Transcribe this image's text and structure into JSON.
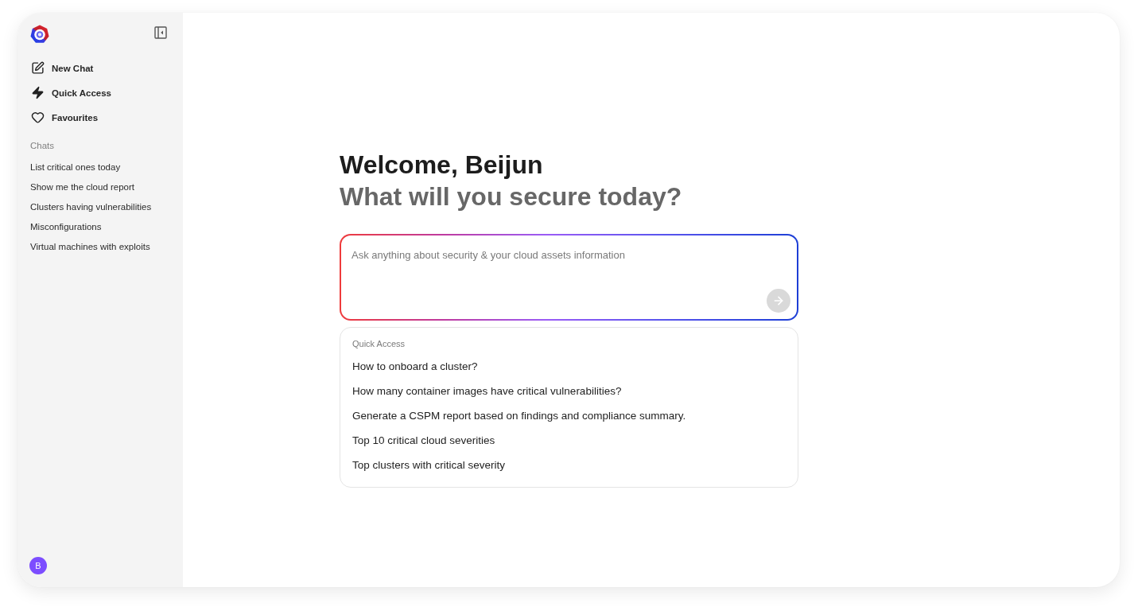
{
  "sidebar": {
    "nav_items": [
      {
        "label": "New Chat"
      },
      {
        "label": "Quick Access"
      },
      {
        "label": "Favourites"
      }
    ],
    "section_title": "Chats",
    "chats": [
      "List critical ones today",
      "Show me the cloud report",
      "Clusters having vulnerabilities",
      "Misconfigurations",
      "Virtual machines with exploits"
    ],
    "user": {
      "initial": "B"
    }
  },
  "main": {
    "greeting": "Welcome, Beijun",
    "prompt": "What will you secure today?",
    "input": {
      "placeholder": "Ask anything about security & your cloud assets information",
      "send_disabled": true
    },
    "quick_access": {
      "title": "Quick Access",
      "items": [
        "How to onboard a cluster?",
        "How many container images have critical vulnerabilities?",
        "Generate a CSPM report based on findings and compliance summary.",
        "Top 10 critical cloud severities",
        "Top clusters with critical severity"
      ]
    }
  }
}
